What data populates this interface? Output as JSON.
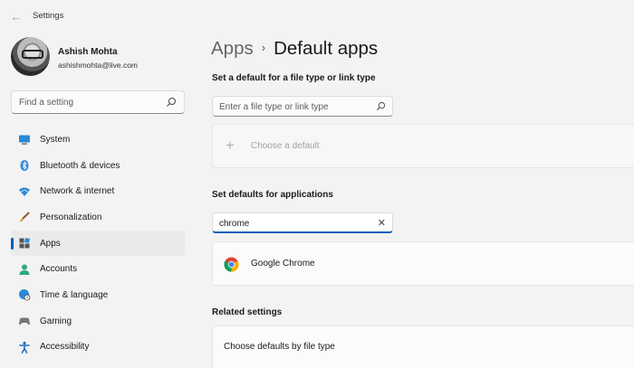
{
  "window": {
    "title": "Settings"
  },
  "user": {
    "name": "Ashish Mohta",
    "email": "ashishmohta@live.com"
  },
  "search": {
    "placeholder": "Find a setting"
  },
  "sidebar": {
    "items": [
      {
        "label": "System",
        "icon": "monitor-icon",
        "selected": false
      },
      {
        "label": "Bluetooth & devices",
        "icon": "bluetooth-icon",
        "selected": false
      },
      {
        "label": "Network & internet",
        "icon": "wifi-icon",
        "selected": false
      },
      {
        "label": "Personalization",
        "icon": "brush-icon",
        "selected": false
      },
      {
        "label": "Apps",
        "icon": "apps-icon",
        "selected": true
      },
      {
        "label": "Accounts",
        "icon": "person-icon",
        "selected": false
      },
      {
        "label": "Time & language",
        "icon": "globe-clock-icon",
        "selected": false
      },
      {
        "label": "Gaming",
        "icon": "gamepad-icon",
        "selected": false
      },
      {
        "label": "Accessibility",
        "icon": "accessibility-icon",
        "selected": false
      }
    ]
  },
  "breadcrumb": {
    "parent": "Apps",
    "separator": "›",
    "current": "Default apps"
  },
  "file_type_section": {
    "heading": "Set a default for a file type or link type",
    "input_placeholder": "Enter a file type or link type",
    "choose_default_label": "Choose a default"
  },
  "applications_section": {
    "heading": "Set defaults for applications",
    "search_value": "chrome",
    "results": [
      {
        "name": "Google Chrome",
        "icon": "chrome-logo-icon"
      }
    ]
  },
  "related_settings": {
    "heading": "Related settings",
    "items": [
      {
        "label": "Choose defaults by file type"
      }
    ]
  },
  "colors": {
    "accent": "#005fb8",
    "background": "#f3f3f3",
    "card": "#fbfbfb"
  }
}
